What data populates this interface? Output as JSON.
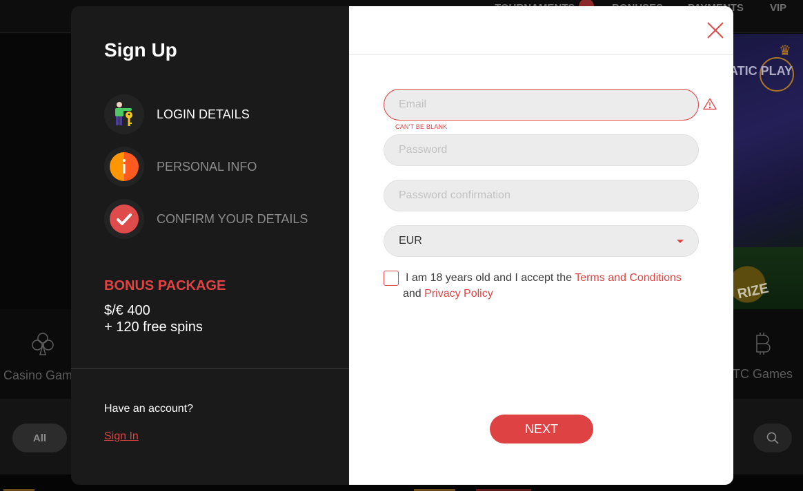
{
  "background": {
    "nav": [
      {
        "label": "TOURNAMENTS",
        "has_badge": true
      },
      {
        "label": "BONUSES"
      },
      {
        "label": "PAYMENTS"
      },
      {
        "label": "VIP"
      }
    ],
    "hero_brand": "ATIC PLAY",
    "hero_prize": "RIZE",
    "categories": [
      {
        "label": "Casino Gam",
        "icon": "club-icon"
      },
      {
        "label": "BTC Games",
        "icon": "bitcoin-icon"
      }
    ],
    "filter_all": "All",
    "search_icon": "search-icon"
  },
  "modal": {
    "title": "Sign Up",
    "steps": [
      {
        "label": "LOGIN DETAILS",
        "icon": "user-key-icon",
        "active": true
      },
      {
        "label": "PERSONAL INFO",
        "icon": "info-icon",
        "active": false
      },
      {
        "label": "CONFIRM YOUR DETAILS",
        "icon": "check-icon",
        "active": false
      }
    ],
    "bonus": {
      "title": "BONUS PACKAGE",
      "line1": "$/€ 400",
      "line2": "+ 120 free spins"
    },
    "have_account": "Have an account?",
    "sign_in": "Sign In",
    "form": {
      "email": {
        "placeholder": "Email",
        "value": "",
        "error": "CAN'T BE BLANK"
      },
      "password": {
        "placeholder": "Password",
        "value": ""
      },
      "password_confirmation": {
        "placeholder": "Password confirmation",
        "value": ""
      },
      "currency": {
        "selected": "EUR"
      },
      "terms": {
        "checked": false,
        "text_before": "I am 18 years old and I accept the ",
        "terms_link": "Terms and Conditions",
        "text_mid": " and ",
        "privacy_link": "Privacy Policy"
      },
      "next_label": "NEXT"
    }
  },
  "colors": {
    "accent": "#df4242",
    "modal_left_bg": "#1a1a1a",
    "field_bg": "#ececec"
  }
}
